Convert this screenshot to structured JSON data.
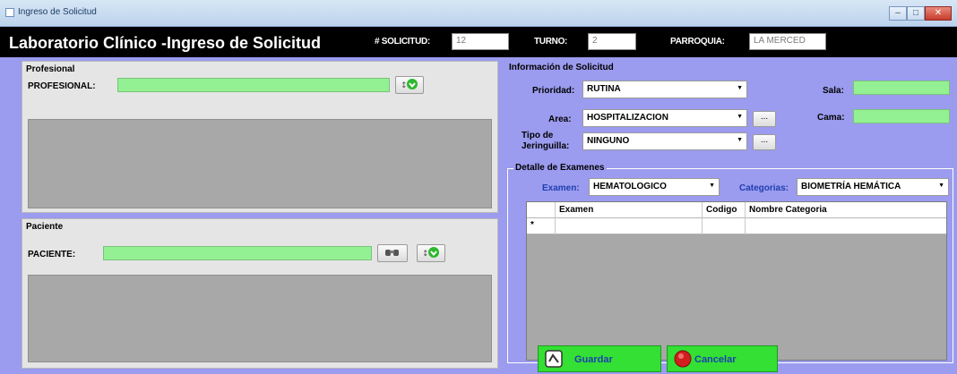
{
  "window": {
    "title": "Ingreso de Solicitud",
    "controls": [
      "minimize",
      "maximize",
      "close"
    ]
  },
  "header": {
    "app_title": "Laboratorio Clínico -Ingreso de  Solicitud",
    "solicitud_label": "# SOLICITUD:",
    "solicitud_value": "12",
    "turno_label": "TURNO:",
    "turno_value": "2",
    "parroquia_label": "PARROQUIA:",
    "parroquia_value": "LA MERCED"
  },
  "profesional": {
    "group_title": "Profesional",
    "label": "PROFESIONAL:",
    "value": ""
  },
  "paciente": {
    "group_title": "Paciente",
    "label": "PACIENTE:",
    "value": ""
  },
  "info": {
    "group_title": "Información de Solicitud",
    "prioridad_label": "Prioridad:",
    "prioridad_value": "RUTINA",
    "area_label": "Area:",
    "area_value": "HOSPITALIZACION",
    "tipo_label_1": "Tipo de",
    "tipo_label_2": "Jeringuilla:",
    "tipo_value": "NINGUNO",
    "sala_label": "Sala:",
    "sala_value": "",
    "cama_label": "Cama:",
    "cama_value": "",
    "ellipsis": "..."
  },
  "detalle": {
    "group_title": "Detalle de Examenes",
    "examen_label": "Examen:",
    "examen_value": "HEMATOLOGICO",
    "categorias_label": "Categorias:",
    "categorias_value": "BIOMETRÍA HEMÁTICA",
    "columns": [
      "Examen",
      "Codigo",
      "Nombre Categoria"
    ],
    "row_marker": "*"
  },
  "actions": {
    "guardar": "Guardar",
    "cancelar": "Cancelar"
  },
  "colors": {
    "field_green": "#93f193",
    "background": "#9b9bef",
    "button_green": "#33e033",
    "label_blue": "#1e3fb0"
  }
}
